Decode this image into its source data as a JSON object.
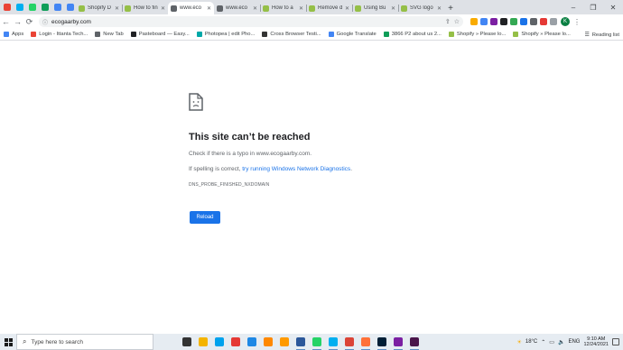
{
  "browser": {
    "pinned_tabs": [
      {
        "icon": "gmail-icon",
        "color": "#ea4335"
      },
      {
        "icon": "skype-icon",
        "color": "#00aff0"
      },
      {
        "icon": "whatsapp-icon",
        "color": "#25d366"
      },
      {
        "icon": "google-sheets-icon",
        "color": "#0f9d58"
      },
      {
        "icon": "google-docs-icon",
        "color": "#4285f4"
      },
      {
        "icon": "google-docs-icon",
        "color": "#4285f4"
      }
    ],
    "tabs": [
      {
        "title": "Shopify D",
        "fav": "#95bf47",
        "active": false
      },
      {
        "title": "How to fin",
        "fav": "#95bf47",
        "active": false
      },
      {
        "title": "www.eco",
        "fav": "#5f6368",
        "active": true
      },
      {
        "title": "www.eco",
        "fav": "#5f6368",
        "active": false
      },
      {
        "title": "How to a",
        "fav": "#95bf47",
        "active": false
      },
      {
        "title": "Remove d",
        "fav": "#95bf47",
        "active": false
      },
      {
        "title": "Using Bu",
        "fav": "#95bf47",
        "active": false
      },
      {
        "title": "SVG logo",
        "fav": "#95bf47",
        "active": false
      }
    ],
    "new_tab_label": "+",
    "window_controls": {
      "minimize": "–",
      "maximize": "❐",
      "close": "✕"
    },
    "toolbar": {
      "back": "←",
      "forward": "→",
      "reload": "⟳",
      "lock": "ⓘ",
      "url": "ecogaarby.com",
      "share": "⇪",
      "star": "☆",
      "extensions": [
        "#f9ab00",
        "#4285f4",
        "#7b1fa2",
        "#202124",
        "#34a853",
        "#1a73e8",
        "#5f6368",
        "#e53935",
        "#9aa0a6"
      ],
      "profile_initial": "K",
      "menu": "⋮"
    },
    "bookmarks": [
      {
        "label": "Apps",
        "color": "#4285f4"
      },
      {
        "label": "Login - Ittanta Tech...",
        "color": "#ea4335"
      },
      {
        "label": "New Tab",
        "color": "#5f6368"
      },
      {
        "label": "Pasteboard — Easy...",
        "color": "#202124"
      },
      {
        "label": "Photopea | edit Pho...",
        "color": "#00a8a8"
      },
      {
        "label": "Cross Browser Testi...",
        "color": "#333333"
      },
      {
        "label": "Google Translate",
        "color": "#4285f4"
      },
      {
        "label": "3866 P2 about us 2...",
        "color": "#0f9d58"
      },
      {
        "label": "Shopify » Please lo...",
        "color": "#95bf47"
      },
      {
        "label": "Shopify » Please lo...",
        "color": "#95bf47"
      }
    ],
    "reading_list": "Reading list"
  },
  "error_page": {
    "title": "This site can’t be reached",
    "line1": "Check if there is a typo in www.ecogaarby.com.",
    "line2_prefix": "If spelling is correct, ",
    "line2_link": "try running Windows Network Diagnostics",
    "line2_suffix": ".",
    "code": "DNS_PROBE_FINISHED_NXDOMAIN",
    "reload_label": "Reload"
  },
  "taskbar": {
    "search_placeholder": "Type here to search",
    "apps": [
      {
        "name": "task-view",
        "color": "#333333"
      },
      {
        "name": "file-explorer",
        "color": "#f4b400"
      },
      {
        "name": "app-l",
        "color": "#00a2ed"
      },
      {
        "name": "app-red",
        "color": "#e53935"
      },
      {
        "name": "edge",
        "color": "#1e88e5"
      },
      {
        "name": "vlc",
        "color": "#ff8800"
      },
      {
        "name": "illustrator",
        "color": "#ff9a00"
      },
      {
        "name": "word",
        "color": "#2b579a"
      },
      {
        "name": "whatsapp",
        "color": "#25d366"
      },
      {
        "name": "skype",
        "color": "#00aff0"
      },
      {
        "name": "chrome",
        "color": "#db4437"
      },
      {
        "name": "firefox",
        "color": "#ff7139"
      },
      {
        "name": "photoshop",
        "color": "#001e36"
      },
      {
        "name": "app-purple",
        "color": "#7b1fa2"
      },
      {
        "name": "slack",
        "color": "#4a154b"
      }
    ],
    "temperature": "18°C",
    "language": "ENG",
    "time": "9:10 AM",
    "date": "12/24/2021"
  }
}
